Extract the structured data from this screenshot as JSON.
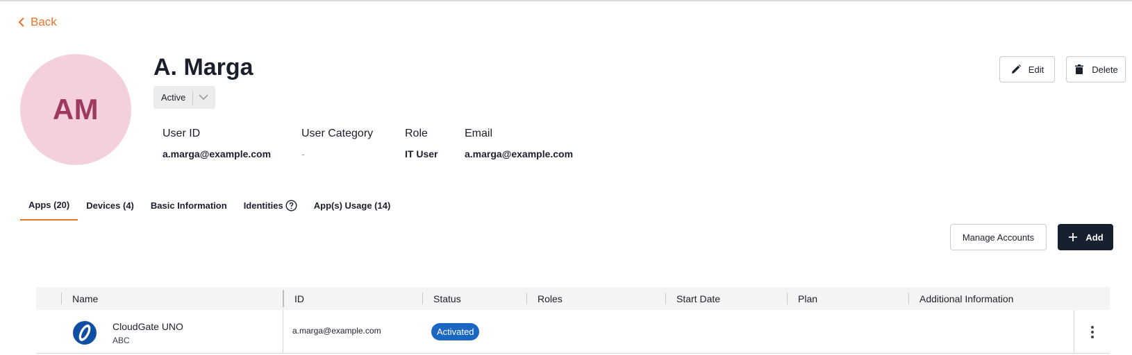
{
  "nav": {
    "back_label": "Back"
  },
  "profile": {
    "initials": "AM",
    "name": "A. Marga",
    "status": "Active",
    "avatar_bg": "#f3d0dc",
    "avatar_fg": "#9c3b5e"
  },
  "fields": [
    {
      "label": "User ID",
      "value": "a.marga@example.com"
    },
    {
      "label": "User Category",
      "value": "-"
    },
    {
      "label": "Role",
      "value": "IT User"
    },
    {
      "label": "Email",
      "value": "a.marga@example.com"
    }
  ],
  "actions": {
    "edit_label": "Edit",
    "delete_label": "Delete"
  },
  "tabs": [
    {
      "label": "Apps (20)",
      "active": true
    },
    {
      "label": "Devices (4)"
    },
    {
      "label": "Basic Information"
    },
    {
      "label": "Identities"
    },
    {
      "label": "App(s) Usage (14)"
    }
  ],
  "toolbar": {
    "manage_label": "Manage Accounts",
    "add_label": "Add"
  },
  "table": {
    "columns": [
      "Name",
      "ID",
      "Status",
      "Roles",
      "Start Date",
      "Plan",
      "Additional Information"
    ],
    "rows": [
      {
        "icon": "cloudgate-logo-icon",
        "name": "CloudGate UNO",
        "sub": "ABC",
        "id": "a.marga@example.com",
        "status": "Activated",
        "roles": "",
        "start_date": "",
        "plan": "",
        "additional": ""
      }
    ]
  },
  "colors": {
    "accent": "#e8742a",
    "primary_dark": "#17202e",
    "badge": "#1967c2"
  }
}
